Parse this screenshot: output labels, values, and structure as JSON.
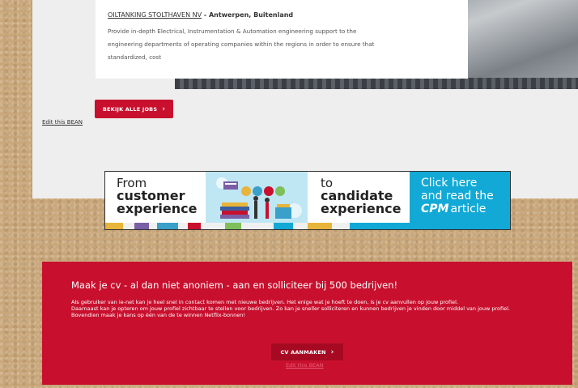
{
  "job": {
    "company": "OILTANKING STOLTHAVEN NV",
    "location": " - Antwerpen, Buitenland",
    "description": "Provide in-depth Electrical, Instrumentation & Automation engineering support to the engineering departments of operating companies within the regions in order to ensure that standardized, cost"
  },
  "jobs_button": {
    "label": "BEKIJK ALLE JOBS",
    "chevron": "›",
    "icon": "chevron-right-icon"
  },
  "edit_bean_top": "Edit this BEAN",
  "banner": {
    "left_line1": "From",
    "left_line2": "customer",
    "left_line3": "experience",
    "mid_line1": "to",
    "mid_line2": "candidate",
    "mid_line3": "experience",
    "cta_line1": "Click here",
    "cta_line2": "and read the",
    "cta_logo": "CPM",
    "cta_word": "article",
    "stripe_colors": [
      "#e8b43a",
      "#f0f0f0",
      "#7a5fa5",
      "#f0f0f0",
      "#3aa0c9",
      "#f0f0f0",
      "#c8102e",
      "#f0f0f0",
      "#7fbf5a",
      "#f0f0f0",
      "#12a9d6",
      "#f0f0f0",
      "#e8b43a",
      "#f0f0f0",
      "#12a9d6"
    ]
  },
  "cv": {
    "title": "Maak je cv - al dan niet anoniem - aan en solliciteer bij 500 bedrijven!",
    "p1": "Als gebruiker van ie-net kan je heel snel in contact komen met nieuwe bedrijven. Het enige wat je hoeft te doen, is je cv aanvullen op jouw profiel.",
    "p2": "Daarnaast kan je opteren om jouw profiel zichtbaar te stellen voor bedrijven. Zo kan je sneller solliciteren en kunnen bedrijven je vinden door middel van jouw profiel.",
    "p3": "Bovendien maak je kans op één van de te winnen Netflix-bonnen!",
    "button_label": "CV AANMAKEN",
    "chevron": "›",
    "edit_bean": "Edit this BEAN"
  },
  "colors": {
    "brand_red": "#c8102e",
    "banner_cta_blue": "#12a9d6",
    "section_gray": "#eeeeee"
  }
}
